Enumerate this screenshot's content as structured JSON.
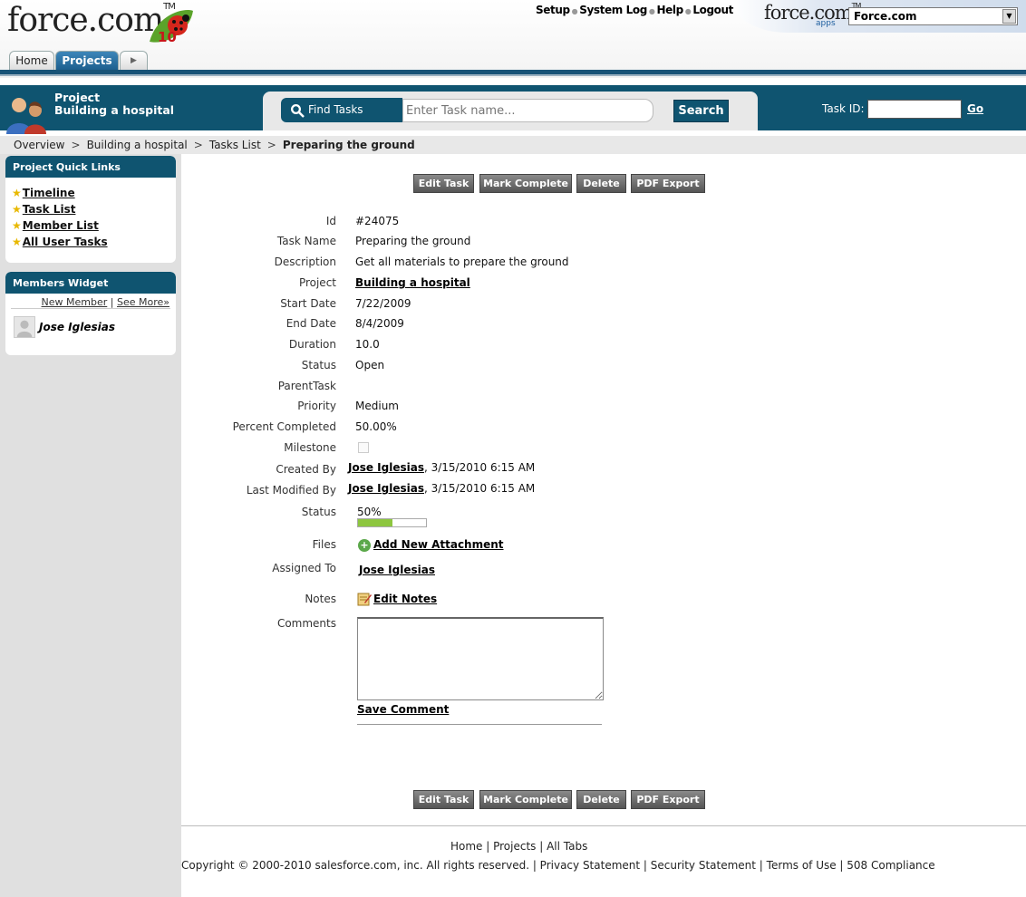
{
  "header": {
    "logo_text": "force.com",
    "logo_badge": "10",
    "top_links": [
      "Setup",
      "System Log",
      "Help",
      "Logout"
    ],
    "apps_logo": "force.com",
    "apps_word": "apps",
    "app_selector_value": "Force.com"
  },
  "tabs": [
    {
      "label": "Home"
    },
    {
      "label": "Projects"
    }
  ],
  "project_band": {
    "label_line1": "Project",
    "label_line2": "Building a hospital",
    "find_tasks_label": "Find Tasks",
    "search_placeholder": "Enter Task name...",
    "search_button": "Search",
    "task_id_label": "Task ID:",
    "go_label": "Go"
  },
  "breadcrumb": [
    "Overview",
    "Building a hospital",
    "Tasks List",
    "Preparing the ground"
  ],
  "sidebar": {
    "quick_links_title": "Project Quick Links",
    "quick_links": [
      "Timeline",
      "Task List",
      "Member List",
      "All User Tasks"
    ],
    "members_title": "Members Widget",
    "new_member_link": "New Member",
    "see_more_link": "See More»",
    "members": [
      "Jose Iglesias"
    ]
  },
  "actions": {
    "edit": "Edit Task",
    "complete": "Mark Complete",
    "delete": "Delete",
    "pdf": "PDF Export"
  },
  "task": {
    "labels": {
      "id": "Id",
      "name": "Task Name",
      "description": "Description",
      "project": "Project",
      "start_date": "Start Date",
      "end_date": "End Date",
      "duration": "Duration",
      "status": "Status",
      "parent_task": "ParentTask",
      "priority": "Priority",
      "percent_completed": "Percent Completed",
      "milestone": "Milestone",
      "created_by": "Created By",
      "last_modified_by": "Last Modified By",
      "status_progress": "Status",
      "files": "Files",
      "assigned_to": "Assigned To",
      "notes": "Notes",
      "comments": "Comments"
    },
    "id": "#24075",
    "name": "Preparing the ground",
    "description": "Get all materials to prepare the ground",
    "project": "Building a hospital",
    "start_date": "7/22/2009",
    "end_date": "8/4/2009",
    "duration": "10.0",
    "status": "Open",
    "parent_task": "",
    "priority": "Medium",
    "percent_completed": "50.00%",
    "milestone_checked": false,
    "created_by": "Jose Iglesias",
    "created_at": ", 3/15/2010 6:15 AM",
    "last_modified_by": "Jose Iglesias",
    "last_modified_at": ", 3/15/2010 6:15 AM",
    "progress_text": "50%",
    "progress_fraction": 0.5,
    "add_attachment": "Add New Attachment",
    "assigned_to": "Jose Iglesias",
    "edit_notes": "Edit Notes",
    "comments_value": "",
    "save_comment": "Save Comment"
  },
  "footer": {
    "links": "Home | Projects | All Tabs",
    "copyright": "Copyright © 2000-2010 salesforce.com, inc. All rights reserved. | Privacy Statement | Security Statement | Terms of Use | 508 Compliance"
  },
  "colors": {
    "brand_blue": "#0f5470",
    "progress_green": "#8dc63f"
  }
}
